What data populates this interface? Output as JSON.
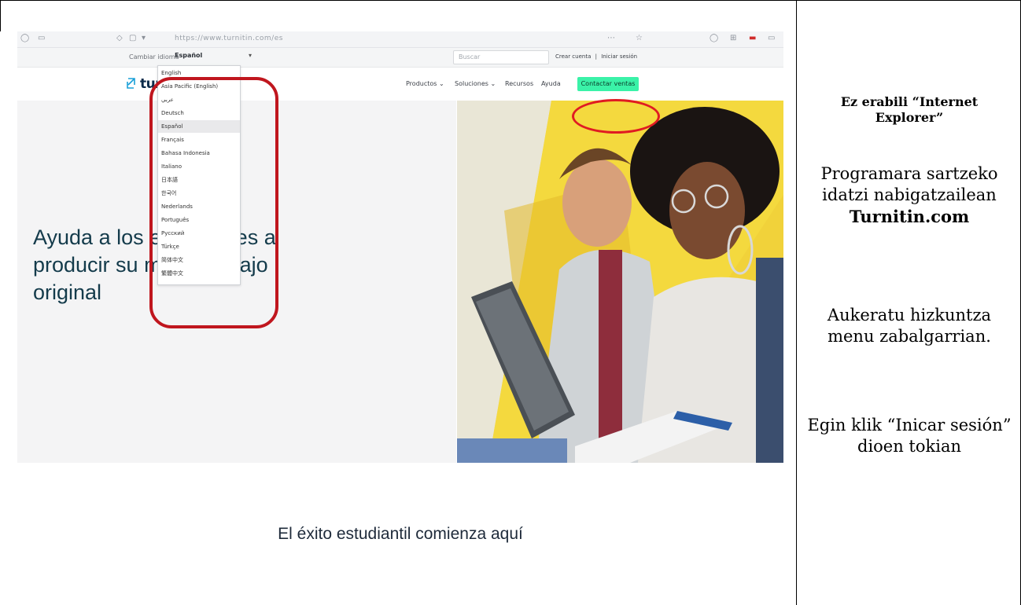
{
  "browser": {
    "url": "https://www.turnitin.com/es",
    "icons": [
      "back-icon",
      "reload-icon",
      "shield-icon",
      "page-icon",
      "menu-icon"
    ]
  },
  "utility_bar": {
    "language_label": "Cambiar idioma",
    "language_selected": "Español",
    "search_placeholder": "Buscar",
    "create_account": "Crear cuenta",
    "separator": "|",
    "sign_in": "Iniciar sesión"
  },
  "language_dropdown": {
    "options": [
      "English",
      "Asia Pacific (English)",
      "عربي",
      "Deutsch",
      "Español",
      "Français",
      "Bahasa Indonesia",
      "Italiano",
      "日本語",
      "한국어",
      "Nederlands",
      "Português",
      "Русский",
      "Türkçe",
      "简体中文",
      "繁體中文"
    ],
    "selected_index": 4
  },
  "nav": {
    "logo_text": "turnitin",
    "items": [
      "Productos ⌄",
      "Soluciones ⌄",
      "Recursos",
      "Ayuda"
    ],
    "cta": "Contactar ventas"
  },
  "hero": {
    "title_lines": [
      "Ayuda a los estudiantes a",
      "producir su mejor trabajo",
      "original"
    ]
  },
  "tagline": "El éxito estudiantil comienza aquí",
  "instructions": {
    "warning": "Ez erabili “Internet Explorer”",
    "step1_pre": "Programara sartzeko idatzi nabigatzailean",
    "step1_bold": "Turnitin.com",
    "step2": "Aukeratu hizkuntza menu zabalgarrian.",
    "step3": "Egin klik “Inicar sesión” dioen tokian"
  },
  "colors": {
    "cta_bg": "#3af2a8",
    "highlight_red": "#c0161e",
    "hero_text": "#143b4b",
    "photo_yellow": "#f1d23a"
  }
}
